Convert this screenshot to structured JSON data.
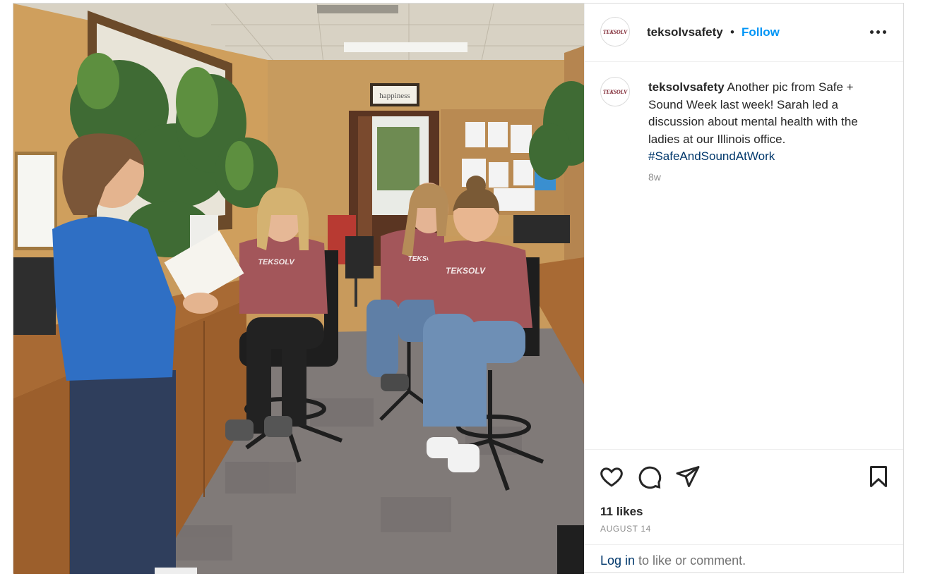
{
  "post": {
    "photo_alt": "",
    "account": {
      "username": "teksolvsafety",
      "avatar_text": "TEKSOLV",
      "separator": "•",
      "follow_label": "Follow"
    },
    "caption": {
      "username": "teksolvsafety",
      "text": "Another pic from Safe + Sound Week last week! Sarah led a discussion about mental health with the ladies at our Illinois office.",
      "hashtag": "#SafeAndSoundAtWork",
      "age": "8w"
    },
    "actions": {
      "like_icon": "heart-icon",
      "comment_icon": "comment-icon",
      "share_icon": "share-icon",
      "save_icon": "bookmark-icon"
    },
    "likes": "11 likes",
    "date": "AUGUST 14",
    "footer": {
      "login_link": "Log in",
      "login_rest": " to like or comment."
    },
    "photo_text": {
      "sign": "happiness",
      "shirt_logo": "TEKSOLV"
    }
  },
  "colors": {
    "follow": "#0095f6",
    "hashtag": "#00376b",
    "muted": "#8e8e8e"
  }
}
